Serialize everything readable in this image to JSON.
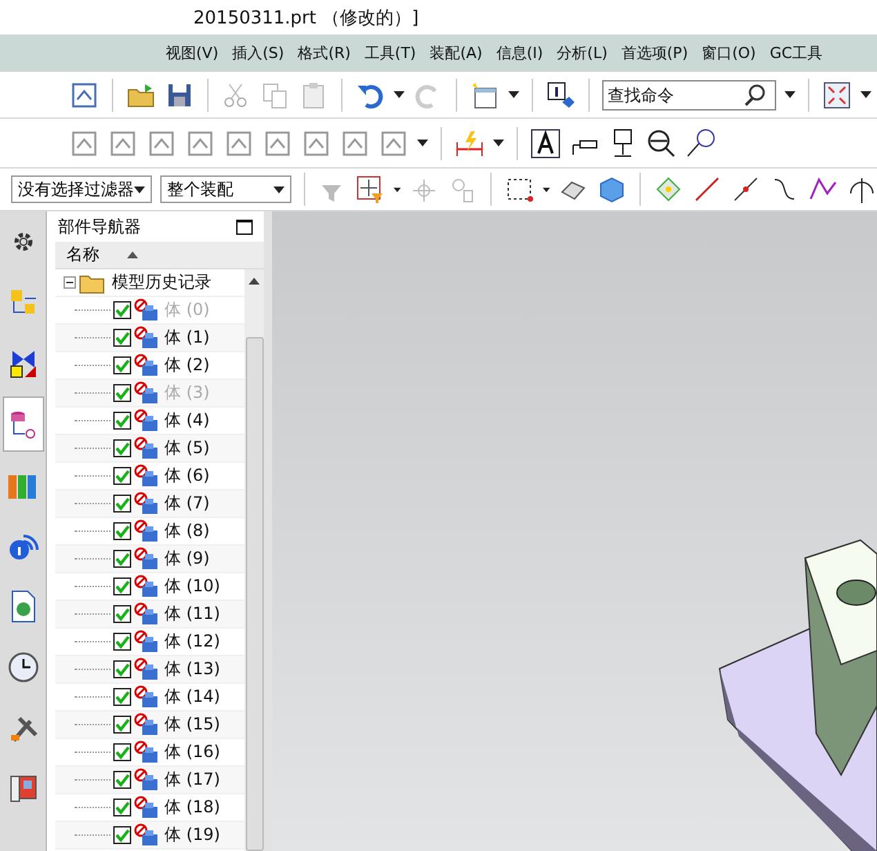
{
  "window": {
    "title": "20150311.prt （修改的）]"
  },
  "menu": [
    {
      "label": "视图(V)"
    },
    {
      "label": "插入(S)"
    },
    {
      "label": "格式(R)"
    },
    {
      "label": "工具(T)"
    },
    {
      "label": "装配(A)"
    },
    {
      "label": "信息(I)"
    },
    {
      "label": "分析(L)"
    },
    {
      "label": "首选项(P)"
    },
    {
      "label": "窗口(O)"
    },
    {
      "label": "GC工具"
    }
  ],
  "search": {
    "placeholder": "查找命令"
  },
  "filters": [
    {
      "value": "没有选择过滤器"
    },
    {
      "value": "整个装配"
    }
  ],
  "navigator": {
    "title": "部件导航器",
    "column": "名称",
    "tree": {
      "label": "模型历史记录",
      "expanded": true,
      "children": [
        {
          "label": "体 (0)",
          "checked": true,
          "disabled": true
        },
        {
          "label": "体 (1)",
          "checked": true,
          "disabled": false
        },
        {
          "label": "体 (2)",
          "checked": true,
          "disabled": false
        },
        {
          "label": "体 (3)",
          "checked": true,
          "disabled": true
        },
        {
          "label": "体 (4)",
          "checked": true,
          "disabled": false
        },
        {
          "label": "体 (5)",
          "checked": true,
          "disabled": false
        },
        {
          "label": "体 (6)",
          "checked": true,
          "disabled": false
        },
        {
          "label": "体 (7)",
          "checked": true,
          "disabled": false
        },
        {
          "label": "体 (8)",
          "checked": true,
          "disabled": false
        },
        {
          "label": "体 (9)",
          "checked": true,
          "disabled": false
        },
        {
          "label": "体 (10)",
          "checked": true,
          "disabled": false
        },
        {
          "label": "体 (11)",
          "checked": true,
          "disabled": false
        },
        {
          "label": "体 (12)",
          "checked": true,
          "disabled": false
        },
        {
          "label": "体 (13)",
          "checked": true,
          "disabled": false
        },
        {
          "label": "体 (14)",
          "checked": true,
          "disabled": false
        },
        {
          "label": "体 (15)",
          "checked": true,
          "disabled": false
        },
        {
          "label": "体 (16)",
          "checked": true,
          "disabled": false
        },
        {
          "label": "体 (17)",
          "checked": true,
          "disabled": false
        },
        {
          "label": "体 (18)",
          "checked": true,
          "disabled": false
        },
        {
          "label": "体 (19)",
          "checked": true,
          "disabled": false
        }
      ]
    }
  },
  "side_tabs": [
    {
      "selected": false
    },
    {
      "selected": false
    },
    {
      "selected": false
    },
    {
      "selected": true
    },
    {
      "selected": false
    },
    {
      "selected": false
    },
    {
      "selected": false
    },
    {
      "selected": false
    },
    {
      "selected": false
    },
    {
      "selected": false
    }
  ]
}
